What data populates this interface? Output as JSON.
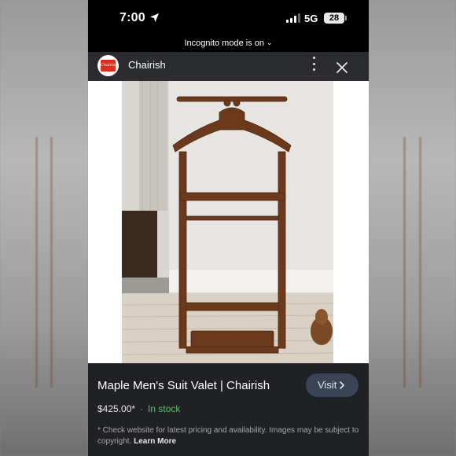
{
  "status_bar": {
    "time": "7:00",
    "network": "5G",
    "battery": "28"
  },
  "incognito_banner": {
    "label": "Incognito mode is on"
  },
  "header": {
    "site_name": "Chairish",
    "site_icon_text": "Chairish"
  },
  "product": {
    "title": "Maple Men's Suit Valet | Chairish",
    "price": "$425.00*",
    "separator": "·",
    "availability": "In stock",
    "visit_label": "Visit"
  },
  "disclaimer": {
    "text": "* Check website for latest pricing and availability. Images may be subject to copyright.",
    "link_label": "Learn More"
  },
  "colors": {
    "header_bg": "#2b2c30",
    "info_bg": "#202124",
    "visit_button_bg": "#394457",
    "in_stock": "#5fbf72",
    "brand_red": "#d7301f"
  },
  "icons": {
    "location": "location-arrow-icon",
    "signal": "signal-bars-icon",
    "battery": "battery-icon",
    "chevron": "chevron-down-icon",
    "menu": "more-vert-icon",
    "close": "close-icon",
    "visit_chevron": "chevron-right-icon"
  }
}
